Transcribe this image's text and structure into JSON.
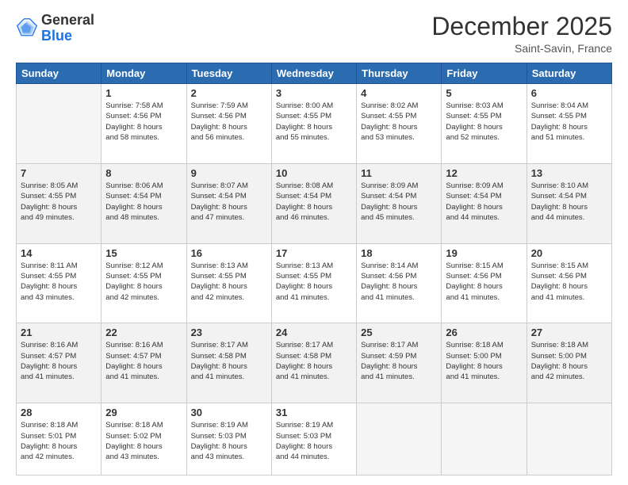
{
  "logo": {
    "general": "General",
    "blue": "Blue"
  },
  "header": {
    "month": "December 2025",
    "location": "Saint-Savin, France"
  },
  "weekdays": [
    "Sunday",
    "Monday",
    "Tuesday",
    "Wednesday",
    "Thursday",
    "Friday",
    "Saturday"
  ],
  "weeks": [
    [
      {
        "day": "",
        "info": ""
      },
      {
        "day": "1",
        "info": "Sunrise: 7:58 AM\nSunset: 4:56 PM\nDaylight: 8 hours\nand 58 minutes."
      },
      {
        "day": "2",
        "info": "Sunrise: 7:59 AM\nSunset: 4:56 PM\nDaylight: 8 hours\nand 56 minutes."
      },
      {
        "day": "3",
        "info": "Sunrise: 8:00 AM\nSunset: 4:55 PM\nDaylight: 8 hours\nand 55 minutes."
      },
      {
        "day": "4",
        "info": "Sunrise: 8:02 AM\nSunset: 4:55 PM\nDaylight: 8 hours\nand 53 minutes."
      },
      {
        "day": "5",
        "info": "Sunrise: 8:03 AM\nSunset: 4:55 PM\nDaylight: 8 hours\nand 52 minutes."
      },
      {
        "day": "6",
        "info": "Sunrise: 8:04 AM\nSunset: 4:55 PM\nDaylight: 8 hours\nand 51 minutes."
      }
    ],
    [
      {
        "day": "7",
        "info": "Sunrise: 8:05 AM\nSunset: 4:55 PM\nDaylight: 8 hours\nand 49 minutes."
      },
      {
        "day": "8",
        "info": "Sunrise: 8:06 AM\nSunset: 4:54 PM\nDaylight: 8 hours\nand 48 minutes."
      },
      {
        "day": "9",
        "info": "Sunrise: 8:07 AM\nSunset: 4:54 PM\nDaylight: 8 hours\nand 47 minutes."
      },
      {
        "day": "10",
        "info": "Sunrise: 8:08 AM\nSunset: 4:54 PM\nDaylight: 8 hours\nand 46 minutes."
      },
      {
        "day": "11",
        "info": "Sunrise: 8:09 AM\nSunset: 4:54 PM\nDaylight: 8 hours\nand 45 minutes."
      },
      {
        "day": "12",
        "info": "Sunrise: 8:09 AM\nSunset: 4:54 PM\nDaylight: 8 hours\nand 44 minutes."
      },
      {
        "day": "13",
        "info": "Sunrise: 8:10 AM\nSunset: 4:54 PM\nDaylight: 8 hours\nand 44 minutes."
      }
    ],
    [
      {
        "day": "14",
        "info": "Sunrise: 8:11 AM\nSunset: 4:55 PM\nDaylight: 8 hours\nand 43 minutes."
      },
      {
        "day": "15",
        "info": "Sunrise: 8:12 AM\nSunset: 4:55 PM\nDaylight: 8 hours\nand 42 minutes."
      },
      {
        "day": "16",
        "info": "Sunrise: 8:13 AM\nSunset: 4:55 PM\nDaylight: 8 hours\nand 42 minutes."
      },
      {
        "day": "17",
        "info": "Sunrise: 8:13 AM\nSunset: 4:55 PM\nDaylight: 8 hours\nand 41 minutes."
      },
      {
        "day": "18",
        "info": "Sunrise: 8:14 AM\nSunset: 4:56 PM\nDaylight: 8 hours\nand 41 minutes."
      },
      {
        "day": "19",
        "info": "Sunrise: 8:15 AM\nSunset: 4:56 PM\nDaylight: 8 hours\nand 41 minutes."
      },
      {
        "day": "20",
        "info": "Sunrise: 8:15 AM\nSunset: 4:56 PM\nDaylight: 8 hours\nand 41 minutes."
      }
    ],
    [
      {
        "day": "21",
        "info": "Sunrise: 8:16 AM\nSunset: 4:57 PM\nDaylight: 8 hours\nand 41 minutes."
      },
      {
        "day": "22",
        "info": "Sunrise: 8:16 AM\nSunset: 4:57 PM\nDaylight: 8 hours\nand 41 minutes."
      },
      {
        "day": "23",
        "info": "Sunrise: 8:17 AM\nSunset: 4:58 PM\nDaylight: 8 hours\nand 41 minutes."
      },
      {
        "day": "24",
        "info": "Sunrise: 8:17 AM\nSunset: 4:58 PM\nDaylight: 8 hours\nand 41 minutes."
      },
      {
        "day": "25",
        "info": "Sunrise: 8:17 AM\nSunset: 4:59 PM\nDaylight: 8 hours\nand 41 minutes."
      },
      {
        "day": "26",
        "info": "Sunrise: 8:18 AM\nSunset: 5:00 PM\nDaylight: 8 hours\nand 41 minutes."
      },
      {
        "day": "27",
        "info": "Sunrise: 8:18 AM\nSunset: 5:00 PM\nDaylight: 8 hours\nand 42 minutes."
      }
    ],
    [
      {
        "day": "28",
        "info": "Sunrise: 8:18 AM\nSunset: 5:01 PM\nDaylight: 8 hours\nand 42 minutes."
      },
      {
        "day": "29",
        "info": "Sunrise: 8:18 AM\nSunset: 5:02 PM\nDaylight: 8 hours\nand 43 minutes."
      },
      {
        "day": "30",
        "info": "Sunrise: 8:19 AM\nSunset: 5:03 PM\nDaylight: 8 hours\nand 43 minutes."
      },
      {
        "day": "31",
        "info": "Sunrise: 8:19 AM\nSunset: 5:03 PM\nDaylight: 8 hours\nand 44 minutes."
      },
      {
        "day": "",
        "info": ""
      },
      {
        "day": "",
        "info": ""
      },
      {
        "day": "",
        "info": ""
      }
    ]
  ]
}
